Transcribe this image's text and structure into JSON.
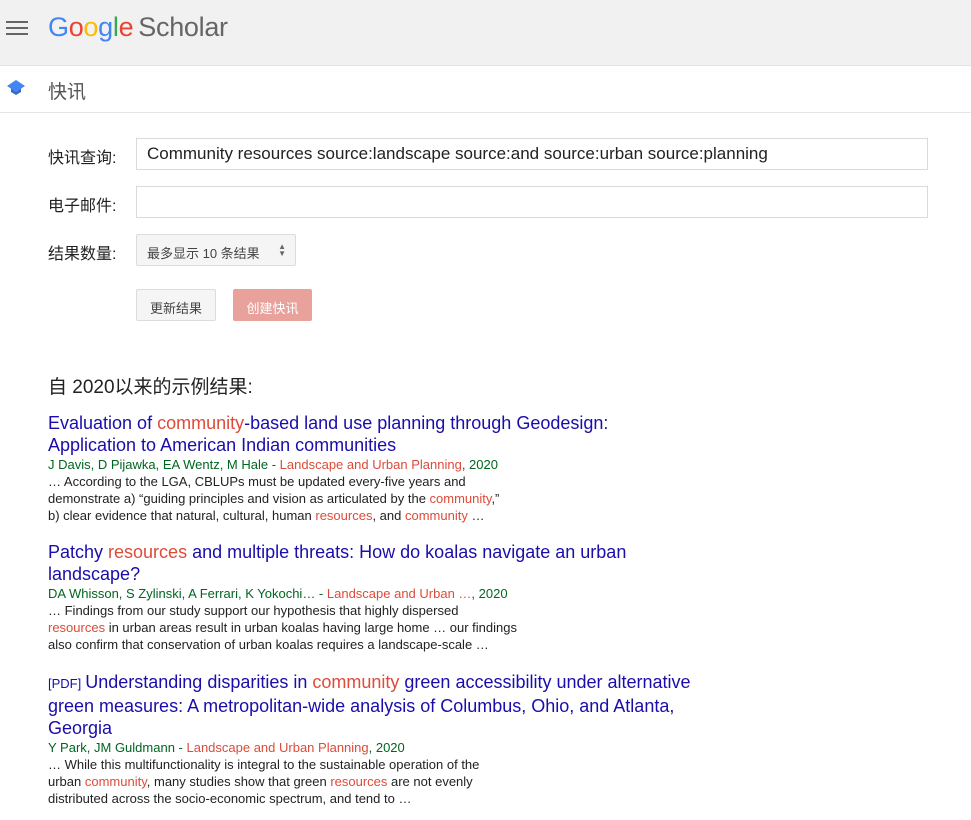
{
  "header": {
    "logo": {
      "G": "G",
      "o1": "o",
      "o2": "o",
      "g": "g",
      "l": "l",
      "e": "e",
      "scholar": "Scholar"
    },
    "subtitle": "快讯"
  },
  "form": {
    "query_label": "快讯查询:",
    "query_value": "Community resources source:landscape source:and source:urban source:planning",
    "email_label": "电子邮件:",
    "email_value": "",
    "count_label": "结果数量:",
    "count_selected": "最多显示 10 条结果",
    "update_button": "更新结果",
    "create_button": "创建快讯"
  },
  "results_heading": "自 2020以来的示例结果:",
  "results": [
    {
      "pdf": "",
      "title_parts": [
        "Evaluation of ",
        "community",
        "-based land use planning through Geodesign: Application to American Indian communities"
      ],
      "authors": "J Davis, D Pijawka, EA Wentz, M Hale - ",
      "source": "Landscape and Urban Planning",
      "year": ", 2020",
      "snippet_lines": [
        [
          "… According to the LGA, CBLUPs must be updated every-five years and"
        ],
        [
          "demonstrate a) “guiding principles and vision as articulated by the ",
          "community",
          ",”"
        ],
        [
          "b) clear evidence that natural, cultural, human ",
          "resources",
          ", and ",
          "community",
          " …"
        ]
      ]
    },
    {
      "pdf": "",
      "title_parts": [
        "Patchy ",
        "resources",
        " and multiple threats: How do koalas navigate an urban landscape?"
      ],
      "authors": "DA Whisson, S Zylinski, A Ferrari, K Yokochi… - ",
      "source": "Landscape and Urban …",
      "year": ", 2020",
      "snippet_lines": [
        [
          "… Findings from our study support our hypothesis that highly dispersed"
        ],
        [
          "",
          "resources",
          " in urban areas result in urban koalas having large home … our findings"
        ],
        [
          "also confirm that conservation of urban koalas requires a landscape-scale …"
        ]
      ]
    },
    {
      "pdf": "[PDF]",
      "title_parts": [
        "Understanding disparities in ",
        "community",
        " green accessibility under alternative green measures: A metropolitan-wide analysis of Columbus, Ohio, and Atlanta, Georgia"
      ],
      "authors": "Y Park, JM Guldmann - ",
      "source": "Landscape and Urban Planning",
      "year": ", 2020",
      "snippet_lines": [
        [
          "… While this multifunctionality is integral to the sustainable operation of the"
        ],
        [
          "urban ",
          "community",
          ", many studies show that green ",
          "resources",
          " are not evenly"
        ],
        [
          "distributed across the socio-economic spectrum, and tend to …"
        ]
      ]
    }
  ]
}
